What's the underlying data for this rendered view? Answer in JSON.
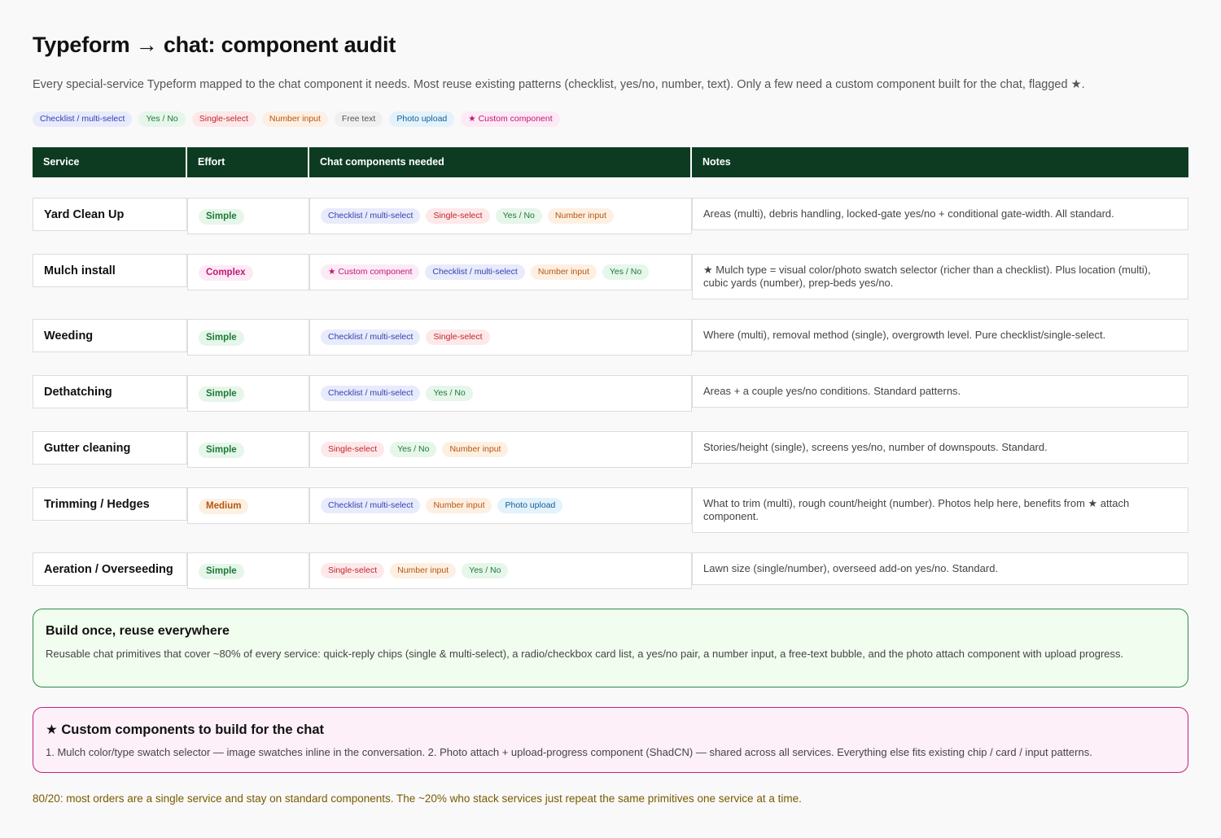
{
  "title": "Typeform → chat: component audit",
  "subtitle": "Every special-service Typeform mapped to the chat component it needs. Most reuse existing patterns (checklist, yes/no, number, text). Only a few need a custom component built for the chat, flagged ★.",
  "legend": {
    "checklist": "Checklist / multi-select",
    "yesno": "Yes / No",
    "single": "Single-select",
    "number": "Number input",
    "free": "Free text",
    "photo": "Photo upload",
    "custom": "★ Custom component"
  },
  "table": {
    "headers": [
      "Service",
      "Effort",
      "Chat components needed",
      "Notes"
    ],
    "rows": [
      {
        "service": "Yard Clean Up",
        "effort": "Simple",
        "components": [
          "Checklist / multi-select",
          "Single-select",
          "Yes / No",
          "Number input"
        ],
        "notes": "Areas (multi), debris handling, locked-gate yes/no + conditional gate-width. All standard."
      },
      {
        "service": "Mulch install",
        "effort": "Complex",
        "components": [
          "★ Custom component",
          "Checklist / multi-select",
          "Number input",
          "Yes / No"
        ],
        "notes": "★ Mulch type = visual color/photo swatch selector (richer than a checklist). Plus location (multi), cubic yards (number), prep-beds yes/no."
      },
      {
        "service": "Weeding",
        "effort": "Simple",
        "components": [
          "Checklist / multi-select",
          "Single-select"
        ],
        "notes": "Where (multi), removal method (single), overgrowth level. Pure checklist/single-select."
      },
      {
        "service": "Dethatching",
        "effort": "Simple",
        "components": [
          "Checklist / multi-select",
          "Yes / No"
        ],
        "notes": "Areas + a couple yes/no conditions. Standard patterns."
      },
      {
        "service": "Gutter cleaning",
        "effort": "Simple",
        "components": [
          "Single-select",
          "Yes / No",
          "Number input"
        ],
        "notes": "Stories/height (single), screens yes/no, number of downspouts. Standard."
      },
      {
        "service": "Trimming / Hedges",
        "effort": "Medium",
        "components": [
          "Checklist / multi-select",
          "Number input",
          "Photo upload"
        ],
        "notes": "What to trim (multi), rough count/height (number). Photos help here, benefits from ★ attach component."
      },
      {
        "service": "Aeration / Overseeding",
        "effort": "Simple",
        "components": [
          "Single-select",
          "Number input",
          "Yes / No"
        ],
        "notes": "Lawn size (single/number), overseed add-on yes/no. Standard."
      }
    ]
  },
  "reuse_box": {
    "title": "Build once, reuse everywhere",
    "body": "Reusable chat primitives that cover ~80% of every service: quick-reply chips (single & multi-select), a radio/checkbox card list, a yes/no pair, a number input, a free-text bubble, and the photo attach component with upload progress."
  },
  "custom_box": {
    "title": "★ Custom components to build for the chat",
    "body": "1. Mulch color/type swatch selector — image swatches inline in the conversation.  2. Photo attach + upload-progress component (ShadCN) — shared across all services.  Everything else fits existing chip / card / input patterns."
  },
  "footer": "80/20: most orders are a single service and stay on standard components. The ~20% who stack services just repeat the same primitives one service at a time.",
  "colors": {
    "header_bg": "#0d3b22",
    "checklist": "#3340b3",
    "yesno": "#1d7a36",
    "single": "#c0262e",
    "number": "#b8550d",
    "photo": "#11609b",
    "custom": "#c01876",
    "green_border": "#2e8b4a",
    "pink_border": "#c4207e",
    "footer_text": "#7a5a00"
  }
}
